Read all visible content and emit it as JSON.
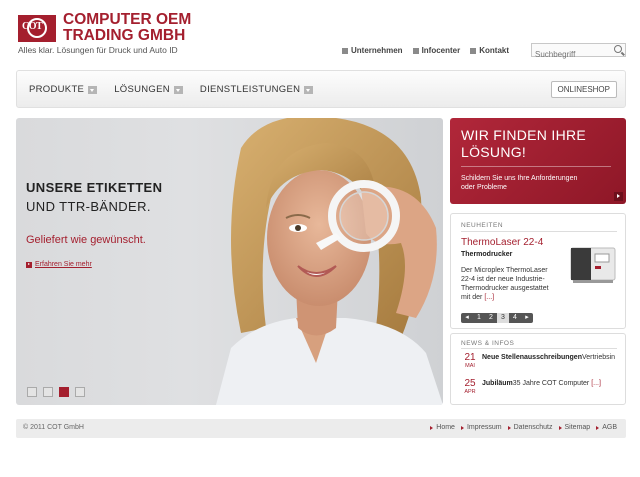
{
  "brand": {
    "logo_text": "COT",
    "name_line1": "COMPUTER OEM",
    "name_line2": "TRADING GMBH",
    "tagline": "Alles klar. Lösungen für Druck und Auto ID",
    "color": "#a41f2e"
  },
  "topnav": [
    {
      "label": "Unternehmen"
    },
    {
      "label": "Infocenter"
    },
    {
      "label": "Kontakt"
    }
  ],
  "search": {
    "placeholder": "Suchbegriff",
    "icon": "search-icon"
  },
  "mainnav": {
    "items": [
      {
        "label": "PRODUKTE"
      },
      {
        "label": "LÖSUNGEN"
      },
      {
        "label": "DIENSTLEISTUNGEN"
      }
    ],
    "shop_label": "ONLINESHOP"
  },
  "hero": {
    "headline_bold": "UNSERE ETIKETTEN",
    "headline_regular": "UND TTR-BÄNDER.",
    "subline": "Geliefert wie gewünscht.",
    "more_link": "Erfahren Sie mehr",
    "slides": 4,
    "active_slide": 3
  },
  "cta": {
    "title_line1": "WIR FINDEN IHRE",
    "title_line2": "LÖSUNG!",
    "description": "Schildern Sie uns Ihre Anforderungen oder Probleme"
  },
  "neuheiten": {
    "heading": "NEUHEITEN",
    "product_title": "ThermoLaser 22-4",
    "product_category": "Thermodrucker",
    "product_desc": "Der Microplex ThermoLaser 22-4 ist der neue Industrie-Thermodrucker ausgestattet mit der",
    "more": "[...]",
    "pager": [
      "◂",
      "1",
      "2",
      "3",
      "4",
      "▸"
    ],
    "current_page": "3"
  },
  "news": {
    "heading": "NEWS & INFOS",
    "items": [
      {
        "day": "21",
        "month": "MAI",
        "title": "Neue Stellenausschreibungen",
        "text": "Vertriebsin"
      },
      {
        "day": "25",
        "month": "APR",
        "title": "Jubiläum",
        "text": "35 Jahre COT Computer",
        "more": "[...]"
      }
    ]
  },
  "footer": {
    "copyright": "© 2011 COT GmbH",
    "links": [
      {
        "label": "Home"
      },
      {
        "label": "Impressum"
      },
      {
        "label": "Datenschutz"
      },
      {
        "label": "Sitemap"
      },
      {
        "label": "AGB"
      }
    ]
  }
}
